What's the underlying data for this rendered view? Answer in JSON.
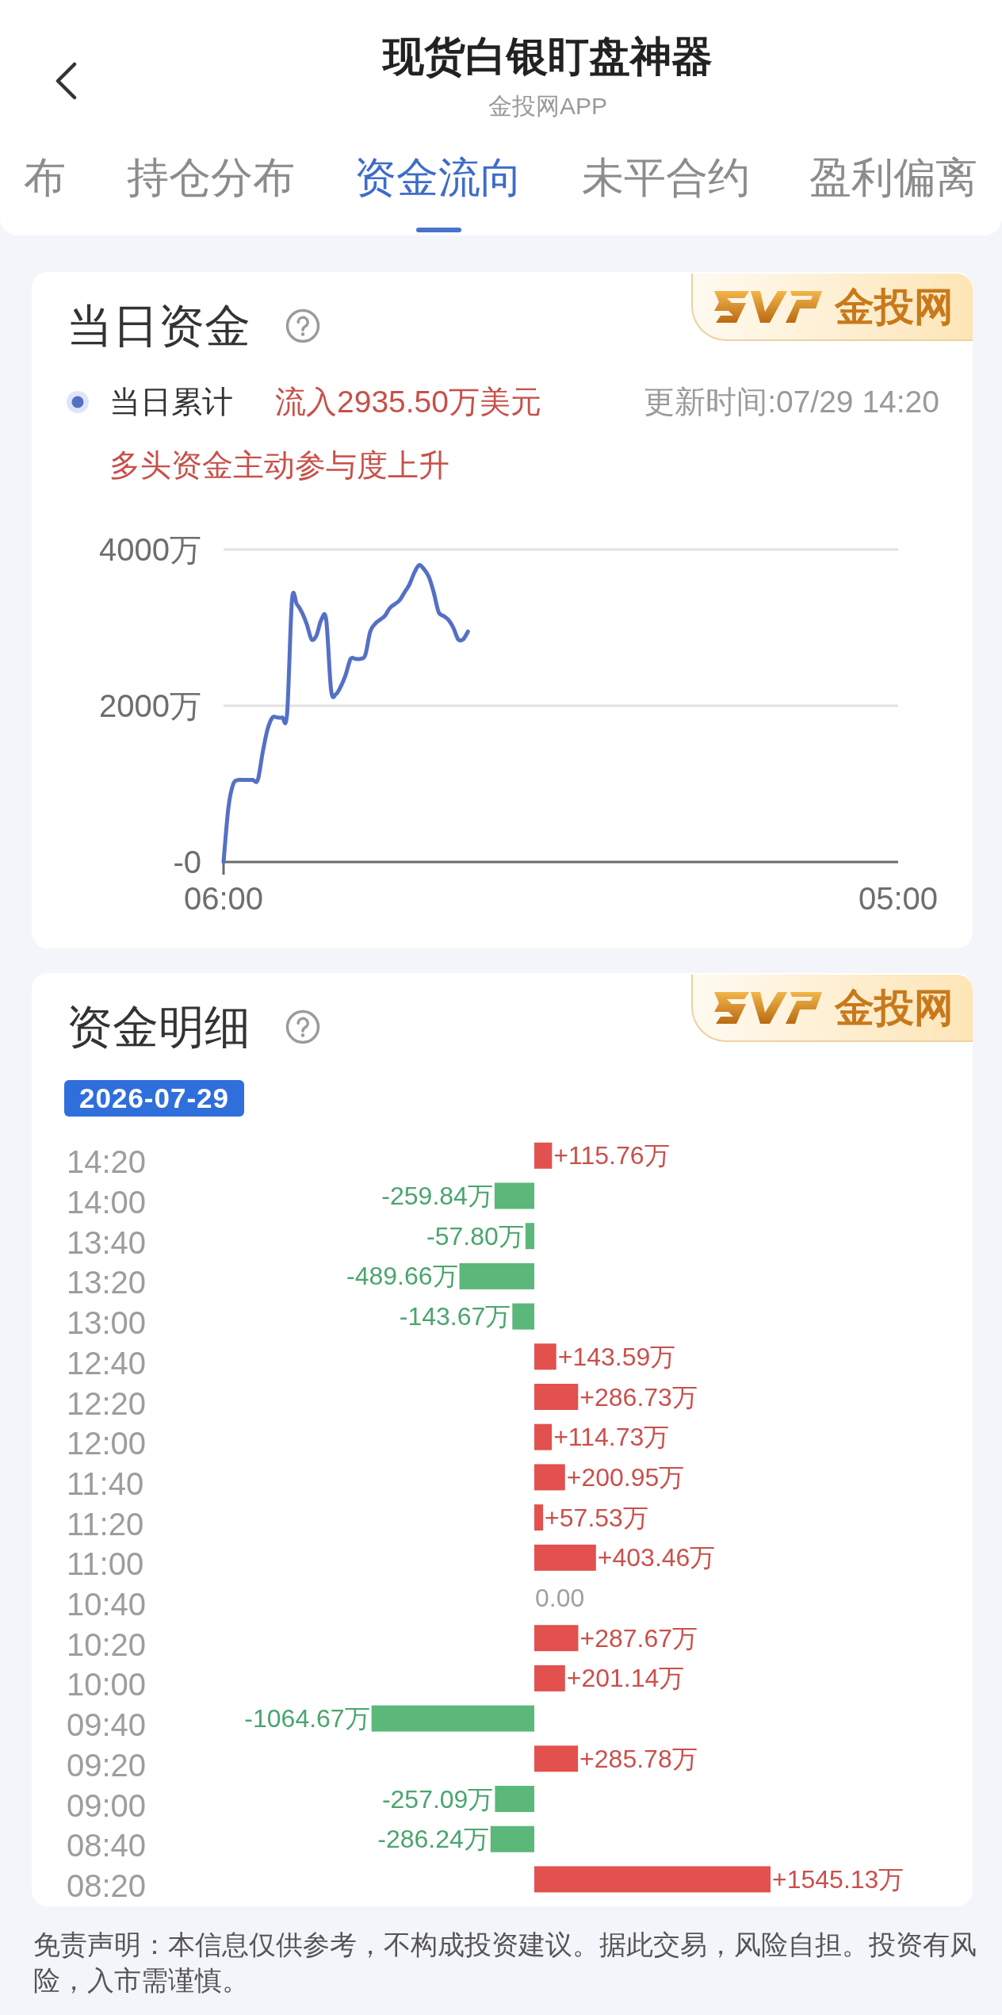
{
  "header": {
    "title": "现货白银盯盘神器",
    "subtitle": "金投网APP"
  },
  "tabs": [
    {
      "label": "布",
      "selected": false
    },
    {
      "label": "持仓分布",
      "selected": false
    },
    {
      "label": "资金流向",
      "selected": true
    },
    {
      "label": "未平合约",
      "selected": false
    },
    {
      "label": "盈利偏离",
      "selected": false
    }
  ],
  "daily_fund": {
    "title": "当日资金",
    "badge": "金投网",
    "inflow": "流入2935.50万美元",
    "updated": "更新时间:07/29 14:20",
    "note": "多头资金主动参与度上升",
    "chart_data": {
      "type": "line",
      "categories": [
        "06:00",
        null,
        null,
        null,
        null,
        null,
        null,
        null,
        null,
        null,
        null,
        null,
        null,
        null,
        null,
        null,
        null,
        null,
        null,
        null,
        null,
        null,
        null,
        null,
        null,
        null,
        null,
        null,
        null,
        null,
        null,
        null,
        null,
        null,
        null,
        null,
        null,
        null,
        null,
        null,
        null,
        null,
        null,
        null,
        null,
        null,
        null,
        null,
        null,
        null,
        null,
        null,
        null,
        null,
        null,
        null,
        null,
        null,
        null,
        null,
        null,
        null,
        null,
        null,
        null,
        null,
        null,
        null,
        null,
        null,
        null,
        null,
        null,
        null,
        null,
        null,
        null,
        null,
        null,
        null,
        null,
        null,
        null,
        null,
        null,
        null,
        null,
        null,
        null,
        null,
        null,
        null,
        null,
        null,
        null,
        null,
        null,
        null,
        null,
        null,
        null,
        null,
        null,
        null,
        null,
        null,
        null,
        null,
        null,
        null,
        null,
        null,
        null,
        null,
        null,
        null,
        null,
        null,
        null,
        null,
        null,
        null,
        null,
        null,
        null,
        null,
        null,
        null,
        null,
        null,
        null,
        null,
        null,
        null,
        null,
        null,
        null,
        null,
        "05:00"
      ],
      "series": [
        {
          "name": "当日累计",
          "color": "#5470c6",
          "values": [
            0,
            700,
            1000,
            1050,
            1050,
            1050,
            1050,
            1050,
            1400,
            1700,
            1850,
            1850,
            1850,
            1900,
            3350,
            3300,
            3200,
            3050,
            2850,
            2900,
            3100,
            3100,
            2200,
            2150,
            2250,
            2400,
            2600,
            2600,
            2600,
            2650,
            2950,
            3050,
            3100,
            3150,
            3250,
            3300,
            3350,
            3450,
            3550,
            3700,
            3800,
            3750,
            3650,
            3450,
            3200,
            3150,
            3100,
            3000,
            2850,
            2850,
            2950,
            null,
            null,
            null,
            null,
            null,
            null,
            null,
            null,
            null,
            null,
            null,
            null,
            null,
            null,
            null,
            null,
            null,
            null,
            null,
            null,
            null,
            null,
            null,
            null,
            null,
            null,
            null,
            null,
            null,
            null,
            null,
            null,
            null,
            null,
            null,
            null,
            null,
            null,
            null,
            null,
            null,
            null,
            null,
            null,
            null,
            null,
            null,
            null,
            null,
            null,
            null,
            null,
            null,
            null,
            null,
            null,
            null,
            null,
            null,
            null,
            null,
            null,
            null,
            null,
            null,
            null,
            null,
            null,
            null,
            null,
            null,
            null,
            null,
            null,
            null,
            null,
            null,
            null,
            null,
            null,
            null,
            null,
            null,
            null,
            null,
            null,
            null,
            null
          ]
        }
      ],
      "ylim": [
        0,
        4000
      ],
      "yticks": [
        {
          "value": 0,
          "label": "-0"
        },
        {
          "value": 2000,
          "label": "2000万"
        },
        {
          "value": 4000,
          "label": "4000万"
        }
      ]
    }
  },
  "fund_detail": {
    "title": "资金明细",
    "badge": "金投网",
    "date": "2026-07-29",
    "chart_data": {
      "type": "bar",
      "orientation": "horizontal",
      "categories": [
        "14:20",
        "14:00",
        "13:40",
        "13:20",
        "13:00",
        "12:40",
        "12:20",
        "12:00",
        "11:40",
        "11:20",
        "11:00",
        "10:40",
        "10:20",
        "10:00",
        "09:40",
        "09:20",
        "09:00",
        "08:40",
        "08:20"
      ],
      "values": [
        115.76,
        -259.84,
        -57.8,
        -489.66,
        -143.67,
        143.59,
        286.73,
        114.73,
        200.95,
        57.53,
        403.46,
        0,
        287.67,
        201.14,
        -1064.67,
        285.78,
        -257.09,
        -286.24,
        1545.13
      ],
      "value_labels": [
        "+115.76万",
        "-259.84万",
        "-57.80万",
        "-489.66万",
        "-143.67万",
        "+143.59万",
        "+286.73万",
        "+114.73万",
        "+200.95万",
        "+57.53万",
        "+403.46万",
        "0.00",
        "+287.67万",
        "+201.14万",
        "-1064.67万",
        "+285.78万",
        "-257.09万",
        "-286.24万",
        "+1545.13万"
      ]
    }
  },
  "disclaimer": "免责声明：本信息仅供参考，不构成投资建议。据此交易，风险自担。投资有风险，入市需谨慎。"
}
